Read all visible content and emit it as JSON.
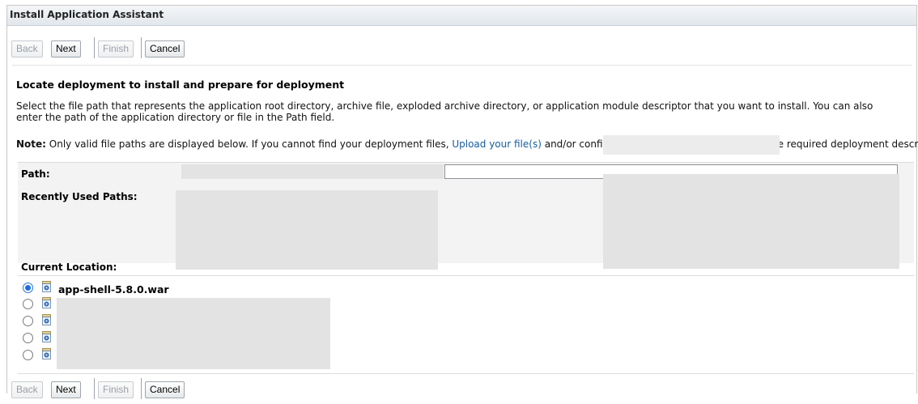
{
  "window": {
    "title": "Install Application Assistant"
  },
  "toolbar": {
    "back": "Back",
    "next": "Next",
    "finish": "Finish",
    "cancel": "Cancel"
  },
  "content": {
    "heading": "Locate deployment to install and prepare for deployment",
    "description": "Select the file path that represents the application root directory, archive file, exploded archive directory, or application module descriptor that you want to install. You can also enter the path of the application directory or file in the Path field.",
    "note_label": "Note:",
    "note_text_before": " Only valid file paths are displayed below. If you cannot find your deployment files, ",
    "note_link": "Upload your file(s)",
    "note_text_after": " and/or confirm that your application contains the required deployment descriptors."
  },
  "form": {
    "path_label": "Path:",
    "path_value": "",
    "recent_label": "Recently Used Paths:",
    "current_location_label": "Current Location:"
  },
  "files": [
    {
      "name": "app-shell-5.8.0.war",
      "selected": true
    },
    {
      "name": "",
      "selected": false
    },
    {
      "name": "",
      "selected": false
    },
    {
      "name": "",
      "selected": false
    },
    {
      "name": "",
      "selected": false
    }
  ],
  "icons": {
    "file": "archive-file-icon"
  }
}
